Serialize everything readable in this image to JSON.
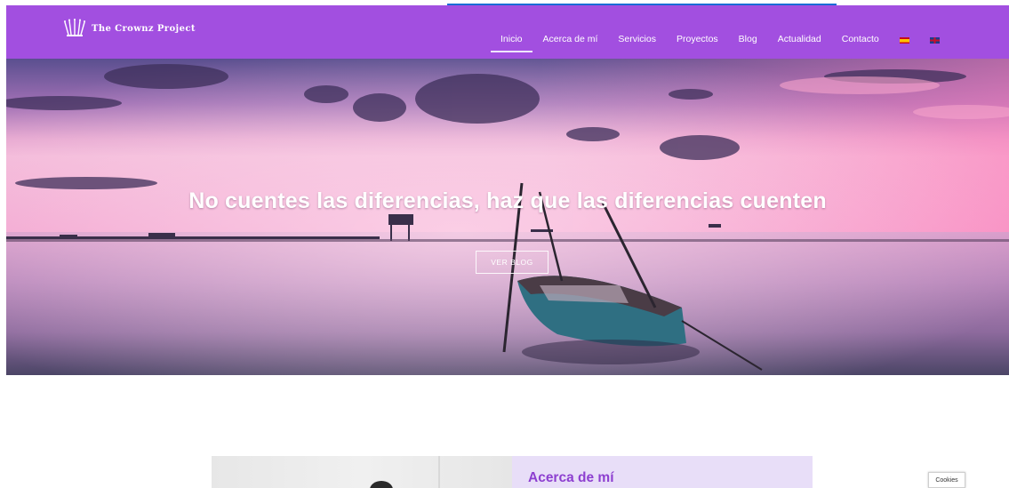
{
  "brand": {
    "name": "The Crownz Project",
    "header_color": "#a24fe0"
  },
  "nav": {
    "items": [
      {
        "label": "Inicio",
        "active": true
      },
      {
        "label": "Acerca de mí",
        "active": false
      },
      {
        "label": "Servicios",
        "active": false
      },
      {
        "label": "Proyectos",
        "active": false
      },
      {
        "label": "Blog",
        "active": false
      },
      {
        "label": "Actualidad",
        "active": false
      },
      {
        "label": "Contacto",
        "active": false
      }
    ],
    "languages": [
      {
        "icon": "spain-flag-icon"
      },
      {
        "icon": "uk-flag-icon"
      }
    ]
  },
  "hero": {
    "title": "No cuentes las diferencias, haz que las diferencias cuenten",
    "button_label": "VER BLOG",
    "image_subject": "boat-sunset-lake"
  },
  "about": {
    "title": "Acerca de mí",
    "accent_color": "#8d3fd0",
    "panel_color": "#e8def8"
  },
  "cookies": {
    "label": "Cookies"
  }
}
